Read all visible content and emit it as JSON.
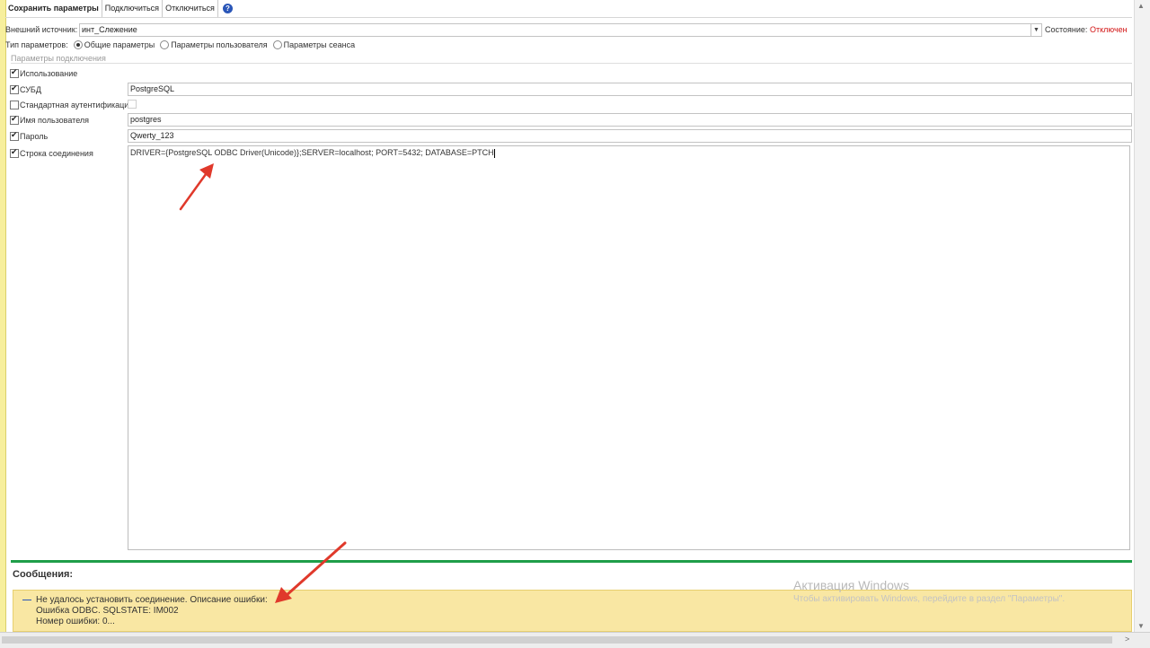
{
  "toolbar": {
    "save_label": "Сохранить параметры",
    "connect_label": "Подключиться",
    "disconnect_label": "Отключиться",
    "help_label": "?"
  },
  "source": {
    "label": "Внешний источник:",
    "value": "инт_Слежение",
    "status_label": "Состояние:",
    "status_value": "Отключен"
  },
  "param_type": {
    "label": "Тип параметров:",
    "options": [
      "Общие параметры",
      "Параметры пользователя",
      "Параметры сеанса"
    ],
    "selected": "Общие параметры"
  },
  "connection": {
    "section_title": "Параметры подключения",
    "usage_label": "Использование",
    "dbms_label": "СУБД",
    "dbms_value": "PostgreSQL",
    "standard_auth_label": "Стандартная аутентификация",
    "user_label": "Имя пользователя",
    "user_value": "postgres",
    "password_label": "Пароль",
    "password_value": "Qwerty_123",
    "conn_string_label": "Строка соединения",
    "conn_string_value": "DRIVER={PostgreSQL ODBC Driver(Unicode)};SERVER=localhost; PORT=5432; DATABASE=PTCH"
  },
  "messages": {
    "title": "Сообщения:",
    "line1": "Не удалось установить соединение. Описание ошибки:",
    "line2": "Ошибка ODBC. SQLSTATE: IM002",
    "line3": "Номер ошибки: 0..."
  },
  "watermark": {
    "title": "Активация Windows",
    "subtitle": "Чтобы активировать Windows, перейдите в раздел \"Параметры\"."
  },
  "colors": {
    "status_red": "#d21313",
    "accent_green": "#1f9e49",
    "message_bg": "#f9e7a3",
    "annotation_red": "#e0392b"
  }
}
